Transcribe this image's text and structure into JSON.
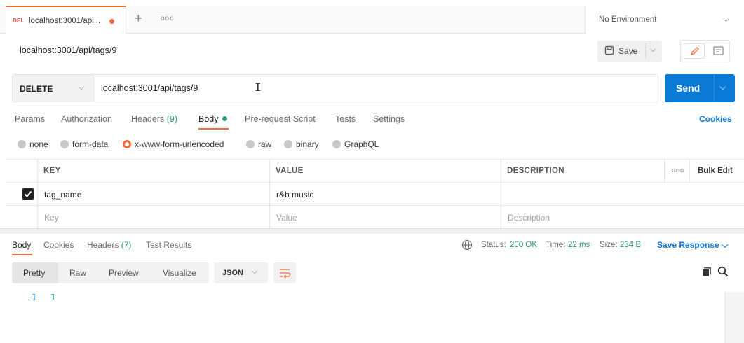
{
  "tabs": {
    "active": {
      "method": "DEL",
      "title": "localhost:3001/api..."
    },
    "more_label": "ooo"
  },
  "environment": {
    "label": "No Environment"
  },
  "request": {
    "title": "localhost:3001/api/tags/9",
    "save_label": "Save",
    "method": "DELETE",
    "url": "localhost:3001/api/tags/9",
    "send_label": "Send"
  },
  "request_tabs": [
    {
      "label": "Params"
    },
    {
      "label": "Authorization"
    },
    {
      "label": "Headers",
      "count": "(9)"
    },
    {
      "label": "Body"
    },
    {
      "label": "Pre-request Script"
    },
    {
      "label": "Tests"
    },
    {
      "label": "Settings"
    }
  ],
  "cookies_label": "Cookies",
  "body_types": [
    {
      "label": "none",
      "selected": false
    },
    {
      "label": "form-data",
      "selected": false
    },
    {
      "label": "x-www-form-urlencoded",
      "selected": true
    },
    {
      "label": "raw",
      "selected": false
    },
    {
      "label": "binary",
      "selected": false
    },
    {
      "label": "GraphQL",
      "selected": false
    }
  ],
  "params_table": {
    "headers": {
      "key": "KEY",
      "value": "VALUE",
      "description": "DESCRIPTION",
      "more": "ooo",
      "bulk_edit": "Bulk Edit"
    },
    "rows": [
      {
        "checked": true,
        "key": "tag_name",
        "value": "r&b music",
        "description": ""
      }
    ],
    "placeholders": {
      "key": "Key",
      "value": "Value",
      "description": "Description"
    }
  },
  "response": {
    "tabs": [
      {
        "label": "Body"
      },
      {
        "label": "Cookies"
      },
      {
        "label": "Headers",
        "count": "(7)"
      },
      {
        "label": "Test Results"
      }
    ],
    "status_label": "Status:",
    "status_value": "200 OK",
    "time_label": "Time:",
    "time_value": "22 ms",
    "size_label": "Size:",
    "size_value": "234 B",
    "save_response_label": "Save Response",
    "formats": [
      "Pretty",
      "Raw",
      "Preview",
      "Visualize"
    ],
    "format_selected": "JSON",
    "lines": [
      {
        "number": "1",
        "content": "1"
      }
    ]
  },
  "colors": {
    "accent": "#f26b3a",
    "primary": "#0a7ad6",
    "success": "#2a9d6a"
  }
}
